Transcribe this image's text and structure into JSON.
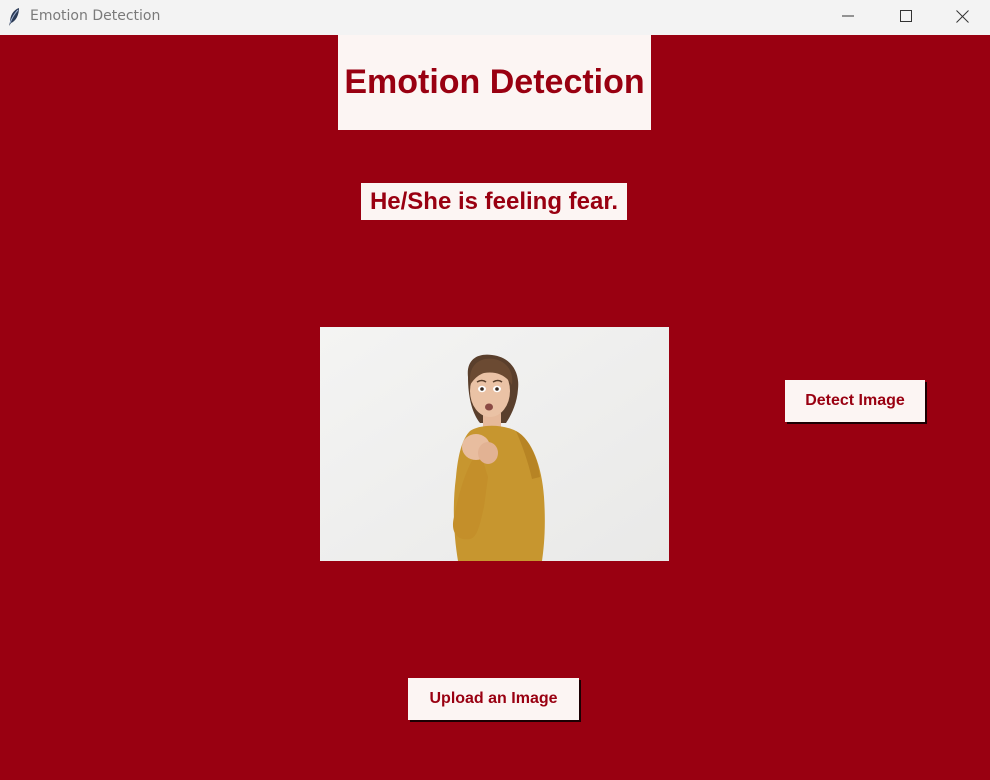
{
  "window": {
    "title": "Emotion Detection",
    "controls": [
      "minimize-icon",
      "maximize-icon",
      "close-icon"
    ]
  },
  "app": {
    "heading": "Emotion Detection",
    "result_text": "He/She is feeling fear.",
    "image": {
      "description_icon": "uploaded-photo",
      "subject": "woman in mustard sweater with frightened expression"
    },
    "buttons": {
      "detect_label": "Detect Image",
      "upload_label": "Upload an Image"
    }
  },
  "colors": {
    "background": "#990011",
    "panel": "#fcf5f3",
    "text_accent": "#990011",
    "titlebar": "#f3f3f3"
  }
}
